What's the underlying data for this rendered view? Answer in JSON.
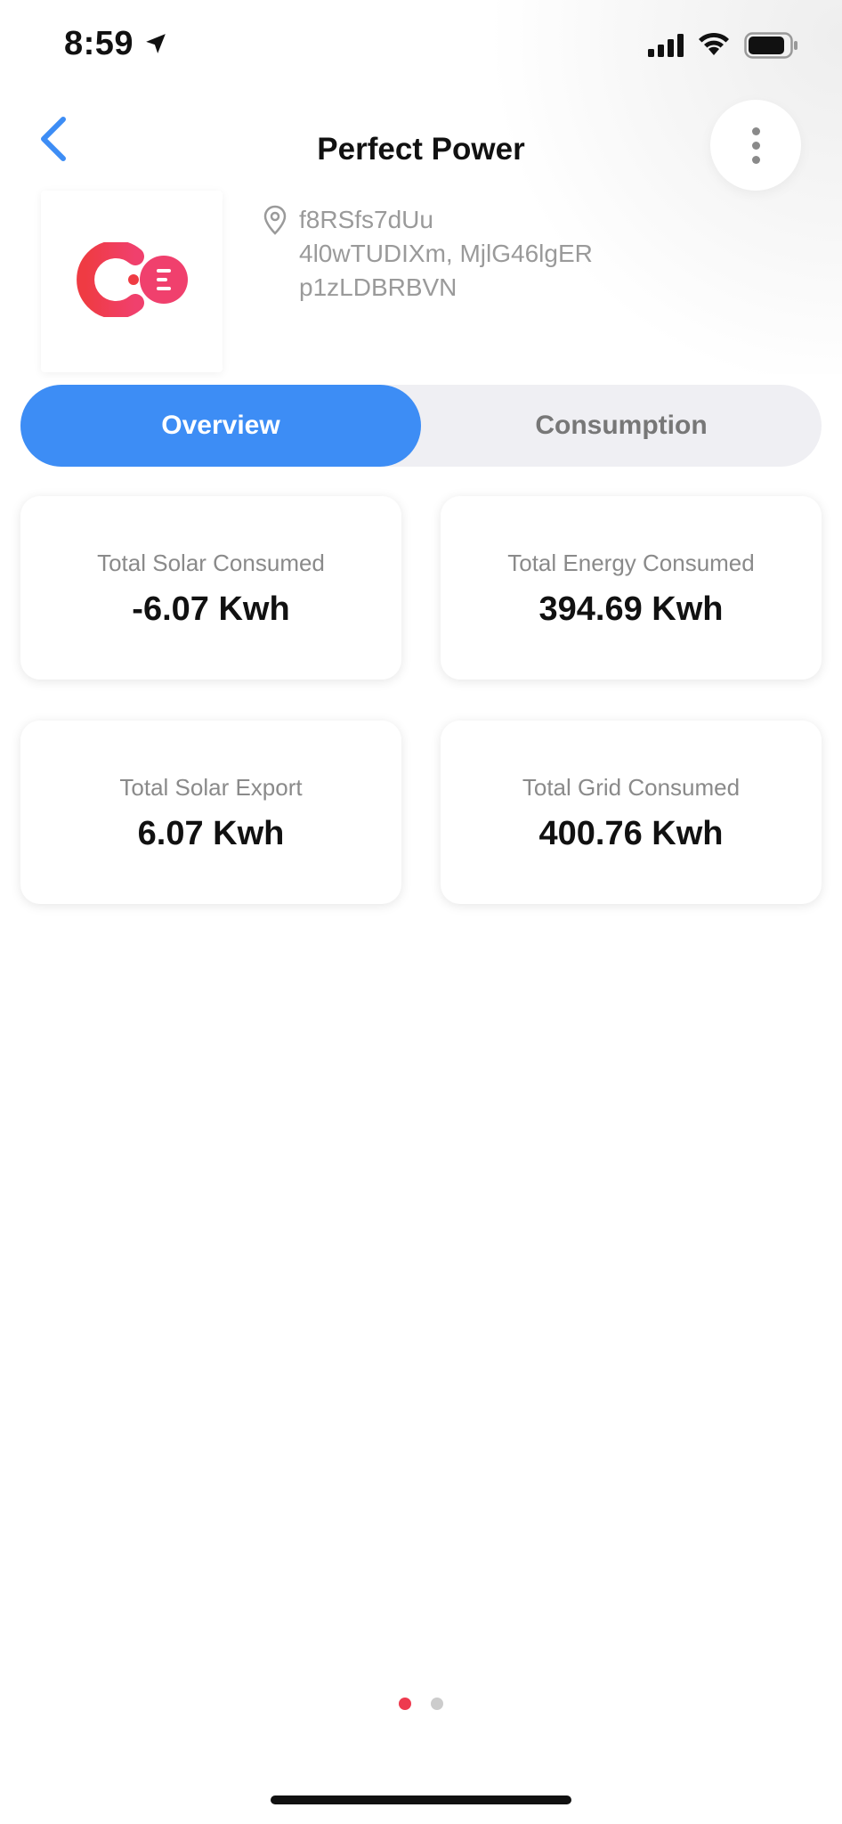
{
  "status_bar": {
    "time": "8:59",
    "icons": [
      "location-arrow-icon",
      "cellular-signal-icon",
      "wifi-icon",
      "battery-icon"
    ]
  },
  "header": {
    "title": "Perfect Power",
    "back_icon": "chevron-left-icon",
    "menu_icon": "more-vertical-icon"
  },
  "site": {
    "logo_icon": "ce-logo",
    "address_icon": "map-pin-icon",
    "address_lines": [
      "f8RSfs7dUu",
      "4l0wTUDIXm, MjlG46lgER",
      "p1zLDBRBVN"
    ]
  },
  "tabs": [
    {
      "label": "Overview",
      "active": true
    },
    {
      "label": "Consumption",
      "active": false
    }
  ],
  "stats": [
    {
      "label": "Total Solar Consumed",
      "value": "-6.07 Kwh"
    },
    {
      "label": "Total Energy Consumed",
      "value": "394.69 Kwh"
    },
    {
      "label": "Total Solar Export",
      "value": "6.07 Kwh"
    },
    {
      "label": "Total Grid Consumed",
      "value": "400.76 Kwh"
    }
  ],
  "pager": {
    "pages": 2,
    "active": 1
  },
  "colors": {
    "accent": "#3d8df5",
    "tab_track": "#efeff3",
    "pager_active": "#ee3a4f",
    "pager_inactive": "#cccccc",
    "logo_red": "#ef3b43",
    "logo_pink": "#f0406d"
  }
}
